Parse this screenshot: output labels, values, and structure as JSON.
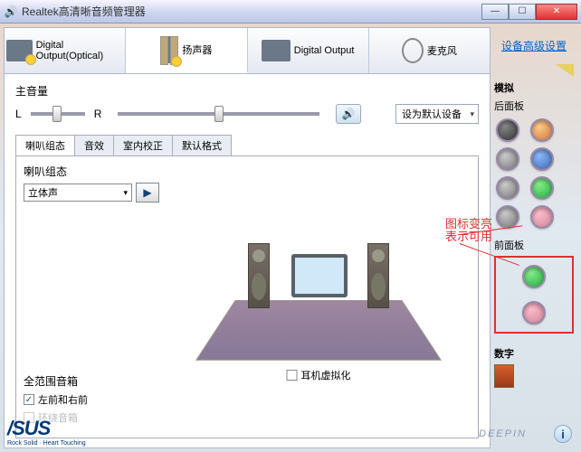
{
  "window": {
    "title": "Realtek高清晰音频管理器"
  },
  "sysbtns": {
    "min": "—",
    "max": "☐",
    "close": "✕"
  },
  "adv_link": "设备高级设置",
  "tabs": [
    {
      "label": "Digital Output(Optical)"
    },
    {
      "label": "扬声器"
    },
    {
      "label": "Digital Output"
    },
    {
      "label": "麦克风"
    }
  ],
  "volume": {
    "label": "主音量",
    "balance_left": "L",
    "balance_right": "R",
    "default_dropdown": "设为默认设备"
  },
  "sub_tabs": [
    "喇叭组态",
    "音效",
    "室内校正",
    "默认格式"
  ],
  "config": {
    "label": "喇叭组态",
    "select_value": "立体声",
    "subwoofer_label": "全范围音箱",
    "chk1": "左前和右前",
    "chk2": "环绕音箱",
    "virtual": "耳机虚拟化"
  },
  "annotation": "图标变亮\n表示可用",
  "right": {
    "sim_label": "模拟",
    "rear_label": "后面板",
    "front_label": "前面板",
    "dig_label": "数字"
  },
  "brand": {
    "name": "/SUS",
    "tag": "Rock Solid · Heart Touching"
  },
  "watermark": "DEEPIN"
}
